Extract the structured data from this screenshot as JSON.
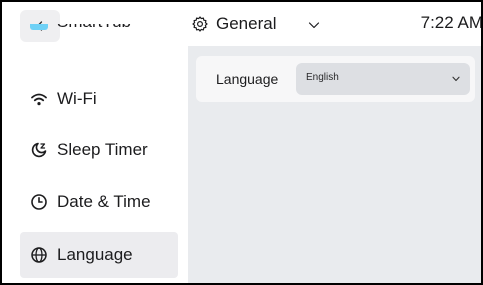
{
  "sidebar": {
    "back_icon": "chevron-left-icon",
    "items": [
      {
        "label": "SmartTub",
        "icon": "smarttub-icon"
      },
      {
        "label": "Wi-Fi",
        "icon": "wifi-icon"
      },
      {
        "label": "Sleep Timer",
        "icon": "sleep-timer-icon"
      },
      {
        "label": "Date & Time",
        "icon": "clock-icon"
      },
      {
        "label": "Language",
        "icon": "globe-icon",
        "active": true
      }
    ]
  },
  "header": {
    "title": "General",
    "icon": "gear-icon",
    "dropdown_icon": "chevron-down-icon",
    "time": "7:22 AM"
  },
  "main": {
    "language_setting": {
      "label": "Language",
      "selected": "English"
    }
  },
  "colors": {
    "content_bg": "#e9ebee",
    "active_item_bg": "#ececef",
    "select_bg": "#dddfe3",
    "smarttub_icon": "#6fd1f6"
  }
}
